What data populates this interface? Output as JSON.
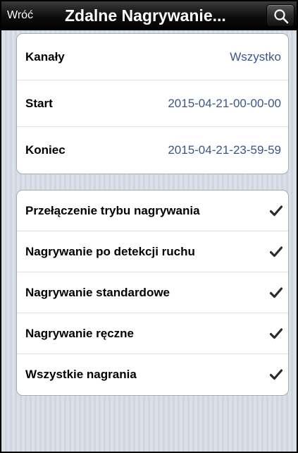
{
  "navbar": {
    "back_label": "Wróć",
    "title": "Zdalne Nagrywanie...",
    "search_icon": "magnifier"
  },
  "filters": [
    {
      "label": "Kanały",
      "value": "Wszystko"
    },
    {
      "label": "Start",
      "value": "2015-04-21-00-00-00"
    },
    {
      "label": "Koniec",
      "value": "2015-04-21-23-59-59"
    }
  ],
  "record_types": [
    {
      "label": "Przełączenie trybu nagrywania",
      "checked": true
    },
    {
      "label": "Nagrywanie po detekcji ruchu",
      "checked": true
    },
    {
      "label": "Nagrywanie standardowe",
      "checked": true
    },
    {
      "label": "Nagrywanie ręczne",
      "checked": true
    },
    {
      "label": "Wszystkie nagrania",
      "checked": true
    }
  ],
  "colors": {
    "value_text": "#3b5688",
    "navbar": "#000000",
    "checkmark": "#2b2b2b"
  }
}
